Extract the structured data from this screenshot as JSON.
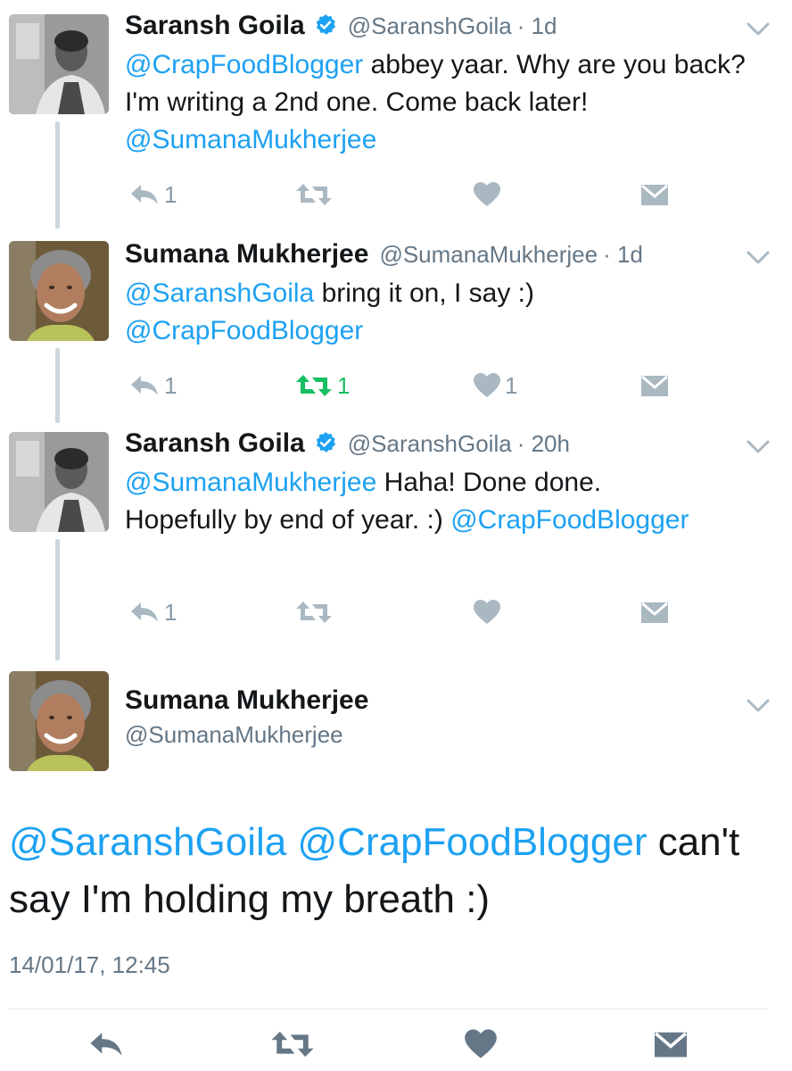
{
  "tweets": [
    {
      "name": "Saransh Goila",
      "verified": true,
      "handle": "@SaranshGoila",
      "time": "· 1d",
      "body": [
        {
          "text": "@CrapFoodBlogger",
          "mention": true
        },
        {
          "text": " abbey yaar. Why are you back? I'm writing a 2nd one. Come back later! ",
          "mention": false
        },
        {
          "text": "@SumanaMukherjee",
          "mention": true
        }
      ],
      "reply_count": "1",
      "retweet_count": "",
      "like_count": "",
      "retweeted": false
    },
    {
      "name": "Sumana Mukherjee",
      "verified": false,
      "handle": "@SumanaMukherjee",
      "time": "· 1d",
      "body": [
        {
          "text": "@SaranshGoila",
          "mention": true
        },
        {
          "text": " bring it on, I say :) ",
          "mention": false
        },
        {
          "text": "@CrapFoodBlogger",
          "mention": true
        }
      ],
      "reply_count": "1",
      "retweet_count": "1",
      "like_count": "1",
      "retweeted": true
    },
    {
      "name": "Saransh Goila",
      "verified": true,
      "handle": "@SaranshGoila",
      "time": "· 20h",
      "body": [
        {
          "text": "@SumanaMukherjee",
          "mention": true
        },
        {
          "text": " Haha! Done done. Hopefully by end of year. :) ",
          "mention": false
        },
        {
          "text": "@CrapFoodBlogger",
          "mention": true
        }
      ],
      "reply_count": "1",
      "retweet_count": "",
      "like_count": "",
      "retweeted": false
    }
  ],
  "main_tweet": {
    "name": "Sumana Mukherjee",
    "handle": "@SumanaMukherjee",
    "body": [
      {
        "text": "@SaranshGoila",
        "mention": true
      },
      {
        "text": " ",
        "mention": false
      },
      {
        "text": "@CrapFoodBlogger",
        "mention": true
      },
      {
        "text": " can't say I'm holding my breath :)",
        "mention": false
      }
    ],
    "timestamp": "14/01/17, 12:45"
  },
  "colors": {
    "mention": "#1da1f2",
    "icon_gray": "#aab8c2",
    "retweet_green": "#17bf63",
    "bottom_icon": "#657786"
  },
  "icons": [
    "reply-icon",
    "retweet-icon",
    "like-icon",
    "direct-message-icon",
    "verified-badge-icon",
    "chevron-down-icon"
  ]
}
